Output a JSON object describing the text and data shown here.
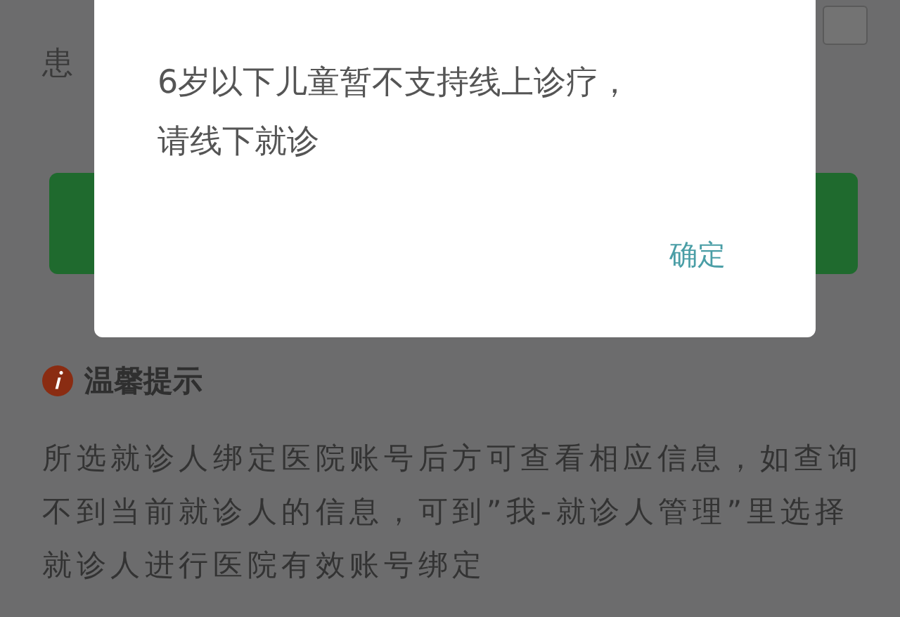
{
  "page": {
    "patient_label": "患",
    "tips": {
      "title": "温馨提示",
      "body": "所选就诊人绑定医院账号后方可查看相应信息，如查询不到当前就诊人的信息，可到”我-就诊人管理”里选择就诊人进行医院有效账号绑定"
    }
  },
  "dialog": {
    "message": "6岁以下儿童暂不支持线上诊疗，请线下就诊",
    "confirm": "确定"
  }
}
